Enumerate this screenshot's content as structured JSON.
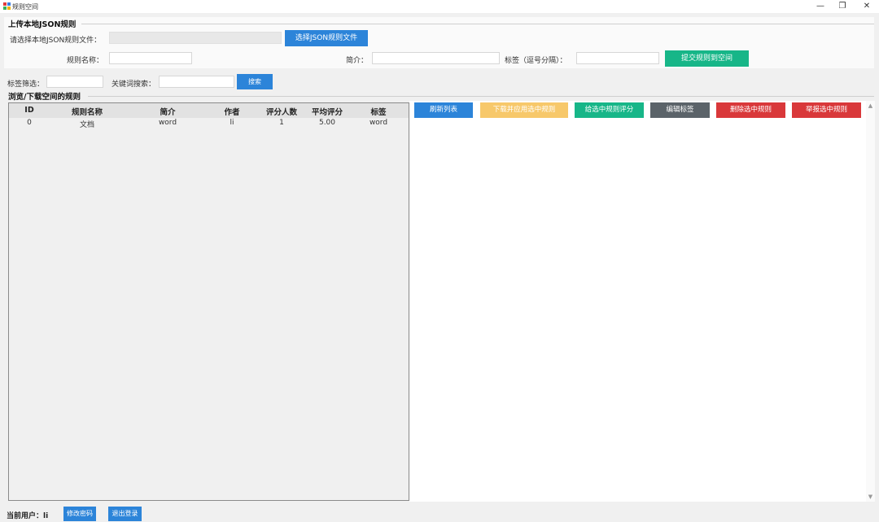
{
  "window": {
    "title": "规则空间",
    "controls": {
      "minimize": "—",
      "restore": "❐",
      "close": "✕"
    }
  },
  "upload": {
    "section_title": "上传本地JSON规则",
    "file_label": "请选择本地JSON规则文件：",
    "file_value": "",
    "choose_button": "选择JSON规则文件",
    "name_label": "规则名称：",
    "name_value": "",
    "desc_label": "简介：",
    "desc_value": "",
    "tags_label": "标签（逗号分隔）：",
    "tags_value": "",
    "submit_button": "提交规则到空间"
  },
  "filter": {
    "tag_label": "标签筛选：",
    "tag_value": "",
    "keyword_label": "关键词搜索：",
    "keyword_value": "",
    "search_button": "搜索"
  },
  "browse": {
    "section_title": "浏览/下载空间的规则",
    "columns": [
      "ID",
      "规则名称",
      "简介",
      "作者",
      "评分人数",
      "平均评分",
      "标签"
    ],
    "rows": [
      [
        "0",
        "文档",
        "word",
        "li",
        "1",
        "5.00",
        "word"
      ]
    ]
  },
  "actions": {
    "refresh": "刷新列表",
    "download_apply": "下载并应用选中规则",
    "rate": "给选中规则评分",
    "edit_tags": "编辑标签",
    "delete": "删除选中规则",
    "report": "举报选中规则"
  },
  "footer": {
    "user_label": "当前用户：li",
    "change_password": "修改密码",
    "logout": "退出登录"
  },
  "colors": {
    "blue": "#2c84d9",
    "green": "#17b688",
    "yellow": "#f7c86a",
    "gray": "#5b6369",
    "red": "#d9383a"
  },
  "icons": {
    "app": "app-logo-icon",
    "scroll_up": "chevron-up-icon",
    "scroll_down": "chevron-down-icon"
  }
}
